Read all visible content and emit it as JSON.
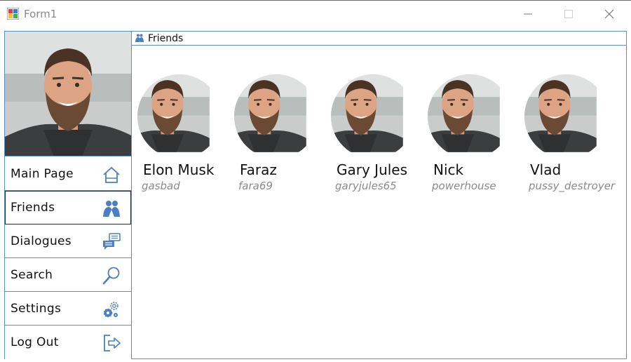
{
  "window": {
    "title": "Form1"
  },
  "sidebar": {
    "items": [
      {
        "label": "Main Page",
        "icon": "home-icon",
        "active": false
      },
      {
        "label": "Friends",
        "icon": "friends-icon",
        "active": true
      },
      {
        "label": "Dialogues",
        "icon": "chat-icon",
        "active": false
      },
      {
        "label": "Search",
        "icon": "search-icon",
        "active": false
      },
      {
        "label": "Settings",
        "icon": "gear-icon",
        "active": false
      },
      {
        "label": "Log Out",
        "icon": "logout-icon",
        "active": false
      }
    ]
  },
  "panel": {
    "title": "Friends"
  },
  "friends": [
    {
      "name": "Elon Musk",
      "username": "gasbad"
    },
    {
      "name": "Faraz",
      "username": "fara69"
    },
    {
      "name": "Gary Jules",
      "username": "garyjules65"
    },
    {
      "name": "Nick",
      "username": "powerhouse"
    },
    {
      "name": "Vlad",
      "username": "pussy_destroyer"
    }
  ],
  "colors": {
    "accent": "#5b8fc7",
    "icon_blue": "#4a7fc1",
    "muted_text": "#8a8a8a"
  }
}
